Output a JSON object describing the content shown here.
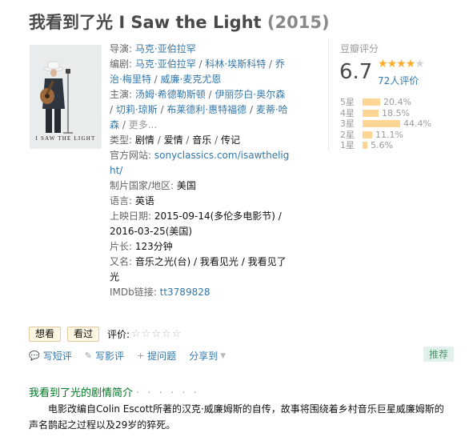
{
  "title": {
    "cn": "我看到了光",
    "en": "I Saw the Light",
    "year": "(2015)"
  },
  "poster": {
    "caption": "I SAW THE LIGHT"
  },
  "info": {
    "director_label": "导演:",
    "director": "马克·亚伯拉罕",
    "writer_label": "编剧:",
    "writers": [
      "马克·亚伯拉罕",
      "科林·埃斯科特",
      "乔治·梅里特",
      "威廉·麦克尤恩"
    ],
    "cast_label": "主演:",
    "cast": [
      "汤姆·希德勒斯顿",
      "伊丽莎白·奥尔森",
      "切莉·琼斯",
      "布莱德利·惠特福德",
      "麦蒂·哈森"
    ],
    "more": "更多...",
    "genre_label": "类型:",
    "genres": [
      "剧情",
      "爱情",
      "音乐",
      "传记"
    ],
    "site_label": "官方网站:",
    "site": "sonyclassics.com/isawthelight/",
    "country_label": "制片国家/地区:",
    "country": "美国",
    "language_label": "语言:",
    "language": "英语",
    "release_label": "上映日期:",
    "release": "2015-09-14(多伦多电影节) / 2016-03-25(美国)",
    "runtime_label": "片长:",
    "runtime": "123分钟",
    "aka_label": "又名:",
    "aka": "音乐之光(台) / 我看见光 / 我看见了光",
    "imdb_label": "IMDb链接:",
    "imdb": "tt3789828"
  },
  "rating": {
    "title": "豆瓣评分",
    "score": "6.7",
    "stars": 3.5,
    "votes": "72人评价",
    "distribution": [
      {
        "label": "5星",
        "percent": 20.4,
        "text": "20.4%"
      },
      {
        "label": "4星",
        "percent": 18.5,
        "text": "18.5%"
      },
      {
        "label": "3星",
        "percent": 44.4,
        "text": "44.4%"
      },
      {
        "label": "2星",
        "percent": 11.1,
        "text": "11.1%"
      },
      {
        "label": "1星",
        "percent": 5.6,
        "text": "5.6%"
      }
    ]
  },
  "actions": {
    "want": "想看",
    "seen": "看过",
    "rate_label": "评价:",
    "rate_stars": "☆☆☆☆☆"
  },
  "subbar": {
    "short_review": "写短评",
    "review": "写影评",
    "question": "提问题",
    "share": "分享到",
    "recommend": "推荐"
  },
  "synopsis": {
    "title": "我看到了光的剧情简介",
    "dots": "· · · · · ·",
    "text": "电影改编自Colin Escott所著的汉克·威廉姆斯的自传，故事将围绕着乡村音乐巨星威廉姆斯的声名鹊起之过程以及29岁的猝死。"
  },
  "colors": {
    "link": "#3377aa",
    "green": "#007722",
    "star": "#ffac2d",
    "bar": "#ffd596"
  }
}
